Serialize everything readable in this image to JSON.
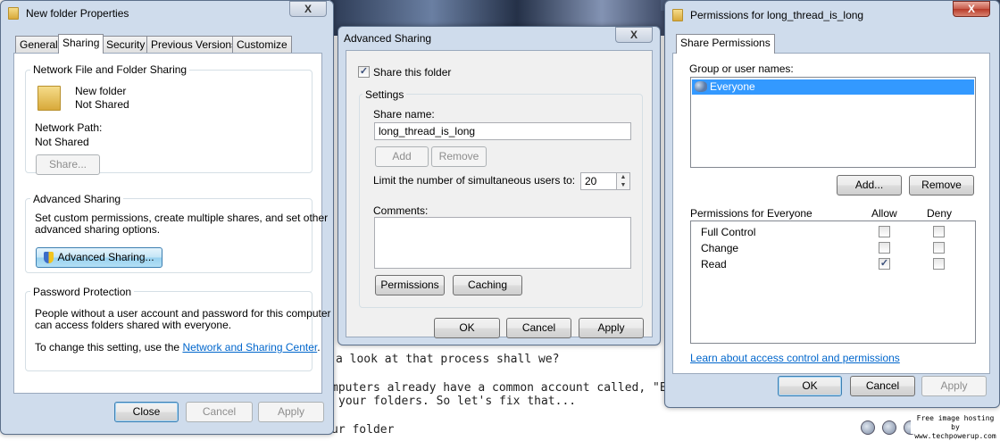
{
  "background": {
    "lines": [
      "a look at that process shall we?",
      "mputers already have a common account called, \"Everyb",
      "your folders.  So let's fix that...",
      "ur folder"
    ],
    "watermark": [
      "Free image hosting by",
      "www.techpowerup.com"
    ]
  },
  "properties": {
    "title": "New folder Properties",
    "close_label": "X",
    "tabs": [
      "General",
      "Sharing",
      "Security",
      "Previous Versions",
      "Customize"
    ],
    "network_sharing": {
      "group_label": "Network File and Folder Sharing",
      "folder_name": "New folder",
      "folder_status": "Not Shared",
      "path_label": "Network Path:",
      "path_value": "Not Shared",
      "share_button": "Share..."
    },
    "advanced": {
      "group_label": "Advanced Sharing",
      "description_line1": "Set custom permissions, create multiple shares, and set other",
      "description_line2": "advanced sharing options.",
      "button": "Advanced Sharing..."
    },
    "password": {
      "group_label": "Password Protection",
      "line1": "People without a user account and password for this computer",
      "line2": "can access folders shared with everyone.",
      "line3_prefix": "To change this setting, use the ",
      "link": "Network and Sharing Center",
      "line3_suffix": "."
    },
    "buttons": {
      "close": "Close",
      "cancel": "Cancel",
      "apply": "Apply"
    }
  },
  "advanced_sharing": {
    "title": "Advanced Sharing",
    "close_label": "X",
    "share_checkbox_label": "Share this folder",
    "share_checked": true,
    "settings_label": "Settings",
    "share_name_label": "Share name:",
    "share_name_value": "long_thread_is_long",
    "add_label": "Add",
    "remove_label": "Remove",
    "limit_label": "Limit the number of simultaneous users to:",
    "limit_value": "20",
    "comments_label": "Comments:",
    "permissions_button": "Permissions",
    "caching_button": "Caching",
    "buttons": {
      "ok": "OK",
      "cancel": "Cancel",
      "apply": "Apply"
    }
  },
  "permissions": {
    "title": "Permissions for long_thread_is_long",
    "close_label": "X",
    "tab": "Share Permissions",
    "group_label": "Group or user names:",
    "users": [
      "Everyone"
    ],
    "add_button": "Add...",
    "remove_button": "Remove",
    "perm_header": "Permissions for Everyone",
    "allow_header": "Allow",
    "deny_header": "Deny",
    "rows": [
      {
        "name": "Full Control",
        "allow": false,
        "deny": false
      },
      {
        "name": "Change",
        "allow": false,
        "deny": false
      },
      {
        "name": "Read",
        "allow": true,
        "deny": false
      }
    ],
    "learn_link": "Learn about access control and permissions",
    "buttons": {
      "ok": "OK",
      "cancel": "Cancel",
      "apply": "Apply"
    }
  }
}
